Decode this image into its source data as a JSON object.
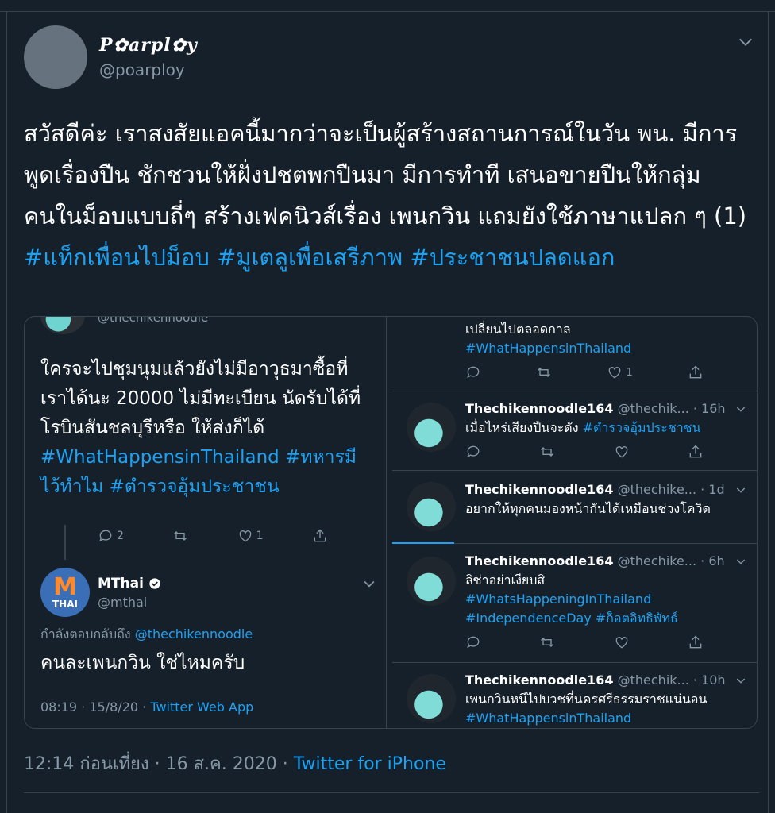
{
  "tweet": {
    "display_name": "P✿arpl✿y",
    "handle": "@poarploy",
    "text_plain": "สวัสดีค่ะ เราสงสัยแอคนี้มากว่าจะเป็นผู้สร้างสถานการณ์ในวัน พน. มีการพูดเรื่องปืน ชักชวนให้ฝั่งปชตพกปืนมา มีการทำที เสนอขายปืนให้กลุ่มคนในม็อบแบบถี่ๆ สร้างเฟคนิวส์เรื่อง เพนกวิน แถมยังใช้ภาษาแปลก ๆ (1) ",
    "hashtags": [
      "#แท็กเพื่อนไปม็อบ",
      "#มูเตลูเพื่อเสรีภาพ",
      "#ประชาชนปลดแอก"
    ],
    "time": "12:14 ก่อนเที่ยง · 16 ส.ค. 2020 · ",
    "source": "Twitter for iPhone"
  },
  "left_panel": {
    "cut_handle": "@thechikennoodle",
    "reply_text": "ใครจะไปชุมนุมแล้วยังไม่มีอาวุธมาซื้อที่เราได้นะ 20000 ไม่มีทะเบียน นัดรับได้ที่โรบินสันชลบุรีหรือ ให้ส่งก็ได้ ",
    "reply_tags": [
      "#WhatHappensinThailand",
      "#ทหารมีไว้ทำไม",
      "#ตำรวจอุ้มประชาชน"
    ],
    "reply_counts": {
      "replies": "2",
      "retweets": "",
      "likes": "1"
    },
    "mthai": {
      "name": "MThai",
      "handle": "@mthai",
      "avatar_m": "M",
      "avatar_text": "THAI",
      "replying_prefix": "กำลังตอบกลับถึง ",
      "replying_to": "@thechikennoodle",
      "text": "คนละเพนกวิน ใช่ไหมครับ",
      "meta": "08:19 · 15/8/20 · ",
      "app": "Twitter Web App"
    }
  },
  "right_panel": {
    "t0": {
      "text": "เปลี่ยนไปตลอดกาล",
      "tag": "#WhatHappensinThailand",
      "likes": "1"
    },
    "t1": {
      "name": "Thechikennoodle164",
      "handle": " @thechik... · 16h",
      "text": "เมื่อไหร่เสียงปืนจะดัง ",
      "tag": "#ตำรวจอุ้มประชาชน"
    },
    "t2": {
      "name": "Thechikennoodle164",
      "handle": " @thechike... · 1d",
      "text": "อยากให้ทุกคนมองหน้ากันได้เหมือนช่วงโควิด"
    },
    "t3": {
      "name": "Thechikennoodle164",
      "handle": " @thechike... · 6h",
      "text": "ลิซ่าอย่าเงียบสิ",
      "tag1": "#WhatsHappeningInThailand",
      "tag2": "#IndependenceDay",
      "tag3": " #ก็อตอิทธิพัทธ์"
    },
    "t4": {
      "name": "Thechikennoodle164",
      "handle": " @thechik... · 10h",
      "text": "เพนกวินหนีไปบวชที่นครศรีธรรมราชแน่นอน",
      "tag": "#WhatHappensinThailand"
    }
  },
  "colors": {
    "background": "#15202b",
    "link": "#1da1f2",
    "muted": "#8899a6",
    "border": "#38444d"
  }
}
